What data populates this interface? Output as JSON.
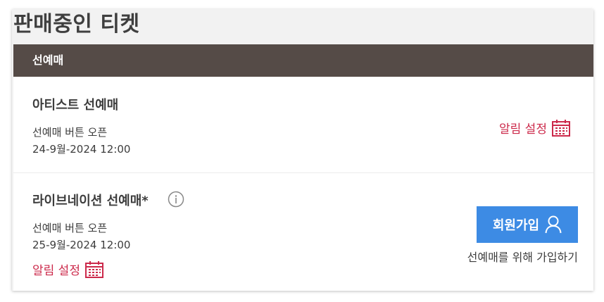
{
  "page": {
    "title": "판매중인 티켓",
    "section_header": "선예매"
  },
  "presales": [
    {
      "name": "아티스트 선예매",
      "open_label": "선예매 버튼 오픈",
      "datetime": "24-9월-2024 12:00",
      "alert_label": "알림 설정"
    },
    {
      "name": "라이브네이션 선예매*",
      "open_label": "선예매 버튼 오픈",
      "datetime": "25-9월-2024 12:00",
      "alert_label": "알림 설정",
      "join_button_label": "회원가입",
      "join_caption": "선예매를 위해 가입하기"
    }
  ],
  "icons": {
    "calendar": "calendar-icon",
    "info": "info-icon",
    "user": "user-icon"
  },
  "colors": {
    "header_bg": "#554b47",
    "alert_red": "#cc2a4b",
    "join_blue": "#3d8be4"
  }
}
